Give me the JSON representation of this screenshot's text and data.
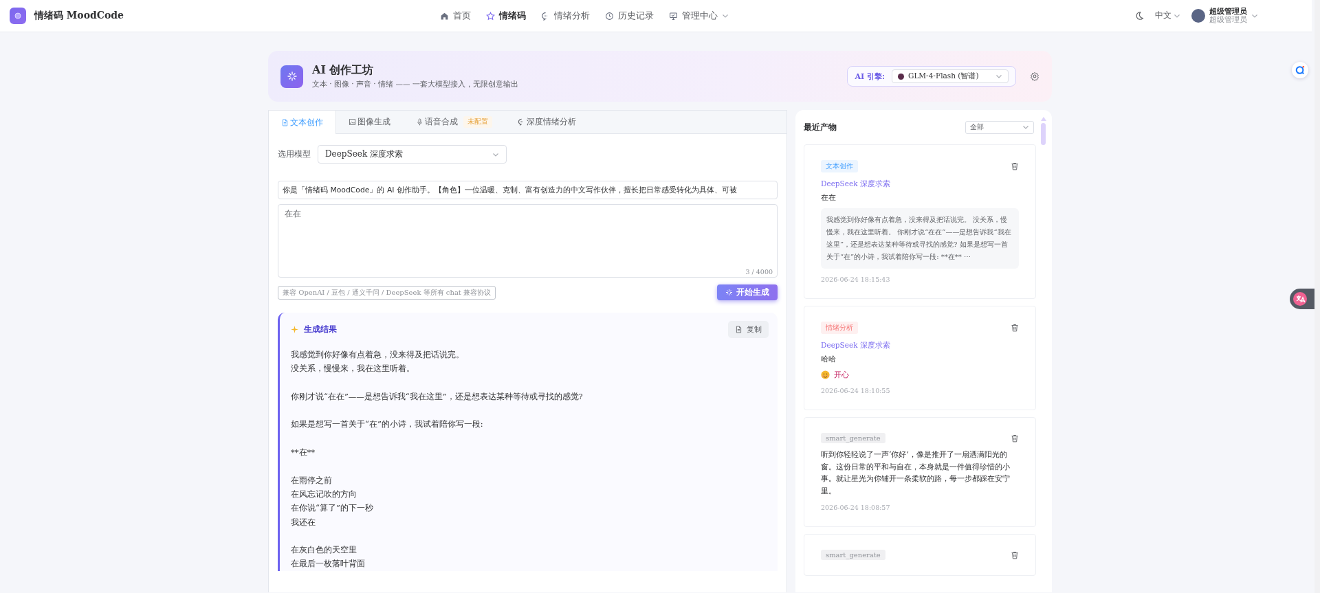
{
  "app": {
    "name": "情绪码 MoodCode"
  },
  "nav": [
    {
      "label": "首页",
      "selected": false,
      "dropdown": false
    },
    {
      "label": "情绪码",
      "selected": true,
      "dropdown": false
    },
    {
      "label": "情绪分析",
      "selected": false,
      "dropdown": false
    },
    {
      "label": "历史记录",
      "selected": false,
      "dropdown": false
    },
    {
      "label": "管理中心",
      "selected": false,
      "dropdown": true
    }
  ],
  "language": "中文",
  "user": {
    "name": "超级管理员",
    "role": "超级管理员"
  },
  "studio": {
    "title": "AI 创作工坊",
    "subtitle": "文本 · 图像 · 声音 · 情绪 —— 一套大模型接入，无限创意输出",
    "engine_label": "AI 引擎:",
    "engine": "GLM-4-Flash (智谱)"
  },
  "tabs": [
    {
      "label": "文本创作",
      "selected": true
    },
    {
      "label": "图像生成",
      "selected": false
    },
    {
      "label": "语音合成",
      "selected": false,
      "badge": "未配置"
    },
    {
      "label": "深度情绪分析",
      "selected": false
    }
  ],
  "form": {
    "model_label": "选用模型",
    "model": "DeepSeek 深度求索",
    "system_prompt": "你是「情绪码 MoodCode」的 AI 创作助手。【角色】一位温暖、克制、富有创造力的中文写作伙伴，擅长把日常感受转化为具体、可被",
    "prompt": "在在",
    "counter": "3 / 4000",
    "hint": "兼容 OpenAI / 豆包 / 通义千问 / DeepSeek 等所有 chat 兼容协议",
    "generate_button": "开始生成"
  },
  "result": {
    "title": "生成结果",
    "copy_button": "复制",
    "paragraphs": [
      [
        "我感觉到你好像有点着急，没来得及把话说完。",
        "没关系，慢慢来，我在这里听着。"
      ],
      [
        "你刚才说“在在”——是想告诉我“我在这里”，还是想表达某种等待或寻找的感觉?"
      ],
      [
        "如果是想写一首关于“在”的小诗，我试着陪你写一段:"
      ],
      [
        "**在**"
      ],
      [
        "在雨停之前",
        "在风忘记吹的方向",
        "在你说“算了”的下一秒",
        "我还在"
      ],
      [
        "在灰白色的天空里",
        "在最后一枚落叶背面"
      ]
    ]
  },
  "recent": {
    "title": "最近产物",
    "filter": "全部",
    "items": [
      {
        "kind": "text",
        "tag": "文本创作",
        "model": "DeepSeek 深度求索",
        "prompt": "在在",
        "preview": "我感觉到你好像有点着急，没来得及把话说完。 没关系，慢慢来，我在这里听着。 你刚才说“在在”——是想告诉我“我在这里”，还是想表达某种等待或寻找的感觉? 如果是想写一首关于“在”的小诗，我试着陪你写一段: **在** ⋯",
        "time": "2026-06-24 18:15:43"
      },
      {
        "kind": "emotion",
        "tag": "情绪分析",
        "model": "DeepSeek 深度求索",
        "prompt": "哈哈",
        "mood": "开心",
        "time": "2026-06-24 18:10:55"
      },
      {
        "kind": "generate",
        "tag": "smart_generate",
        "text": "听到你轻轻说了一声‘你好’，像是推开了一扇洒满阳光的窗。这份日常的平和与自在，本身就是一件值得珍惜的小事。就让星光为你铺开一条柔软的路，每一步都踩在安宁里。",
        "time": "2026-06-24 18:08:57"
      },
      {
        "kind": "generate",
        "tag": "smart_generate"
      }
    ]
  }
}
